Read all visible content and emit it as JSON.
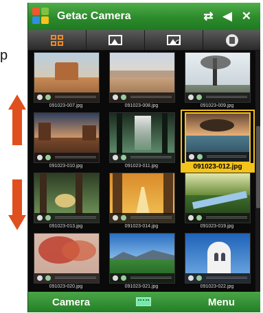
{
  "side_text": "p",
  "window": {
    "title": "Getac Camera"
  },
  "titlebar_icons": {
    "connectivity": "⇄",
    "volume": "◀",
    "close": "✕"
  },
  "toolbar": [
    "thumbnail-view-icon",
    "picture-view-icon",
    "picture-info-icon",
    "delete-icon"
  ],
  "gallery": {
    "items": [
      {
        "name": "091023-007.jpg"
      },
      {
        "name": "091023-008.jpg"
      },
      {
        "name": "091023-009.jpg"
      },
      {
        "name": "091023-010.jpg"
      },
      {
        "name": "091023-011.jpg"
      },
      {
        "name": "091023-012.jpg",
        "selected": true
      },
      {
        "name": "091023-013.jpg"
      },
      {
        "name": "091023-014.jpg"
      },
      {
        "name": "091023-019.jpg"
      },
      {
        "name": "091023-020.jpg"
      },
      {
        "name": "091023-021.jpg"
      },
      {
        "name": "091023-022.jpg"
      }
    ]
  },
  "softkeys": {
    "left": "Camera",
    "right": "Menu"
  },
  "colors": {
    "title_green": "#2c8a2b",
    "selection": "#f3c21b",
    "arrow": "#e0501e"
  }
}
